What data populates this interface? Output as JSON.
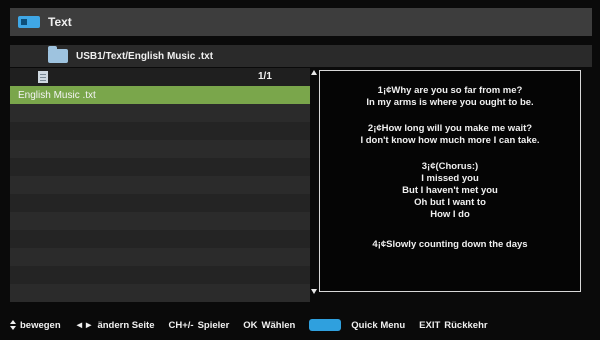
{
  "header": {
    "title": "Text",
    "icon": "tv-icon"
  },
  "pathbar": {
    "path": "USB1/Text/English Music .txt",
    "icon": "folder-icon"
  },
  "list": {
    "page_count": "1/1",
    "items": [
      "English Music .txt"
    ],
    "selected_index": 0,
    "selected_color": "#7aa64b"
  },
  "text_panel": {
    "paragraphs": [
      [
        "1¡¢Why are you so far from me?",
        "In my arms is where you ought to be."
      ],
      [
        "2¡¢How long will you make me wait?",
        "I don't know how much more I can take."
      ],
      [
        "3¡¢(Chorus:)",
        "I missed you",
        "But I haven't met you",
        "Oh but I want to",
        "How I do"
      ],
      [
        "4¡¢Slowly counting down the days"
      ]
    ]
  },
  "footer": {
    "move": "bewegen",
    "change_page_key": "◄►",
    "change_page": "ändern Seite",
    "player_key": "CH+/-",
    "player": "Spieler",
    "ok_key": "OK",
    "ok": "Wählen",
    "quick_menu": "Quick Menu",
    "exit_key": "EXIT",
    "exit": "Rückkehr",
    "blue_color": "#2fa0de"
  }
}
